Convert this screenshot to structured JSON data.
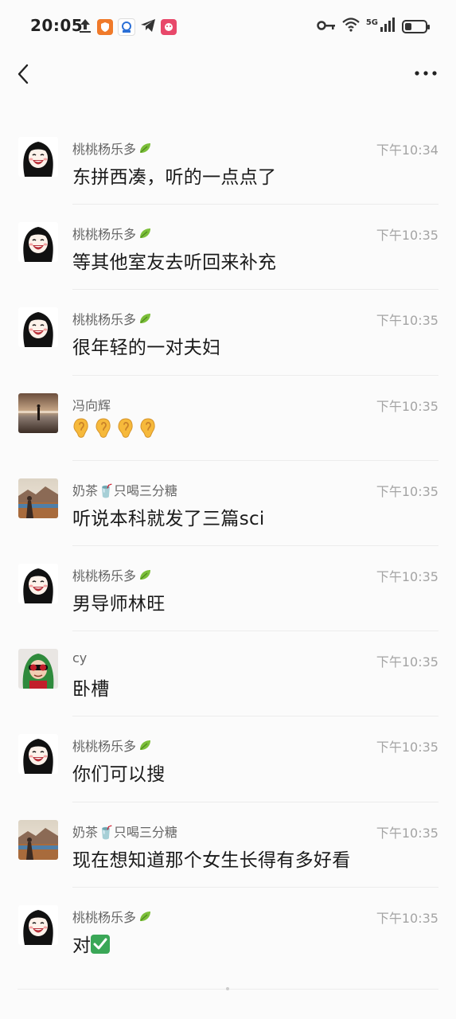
{
  "status_bar": {
    "time": "20:05",
    "network": "5G",
    "battery_level": 0.35,
    "left_icons": [
      "upload-icon",
      "shield-app-icon",
      "bank-app-icon",
      "telegram-icon",
      "game-app-icon"
    ],
    "right_icons": [
      "key-icon",
      "wifi-icon",
      "signal-icon",
      "battery-icon"
    ]
  },
  "nav": {
    "back_icon": "back-chevron-icon",
    "more_icon": "more-dots-icon"
  },
  "messages": [
    {
      "sender": "桃桃杨乐多",
      "leaf": true,
      "time": "下午10:34",
      "text": "东拼西凑，听的一点点了",
      "avatar": "cartoon-girl"
    },
    {
      "sender": "桃桃杨乐多",
      "leaf": true,
      "time": "下午10:35",
      "text": "等其他室友去听回来补充",
      "avatar": "cartoon-girl"
    },
    {
      "sender": "桃桃杨乐多",
      "leaf": true,
      "time": "下午10:35",
      "text": "很年轻的一对夫妇",
      "avatar": "cartoon-girl"
    },
    {
      "sender": "冯向辉",
      "leaf": false,
      "time": "下午10:35",
      "text": "",
      "ears": 4,
      "avatar": "beach-photo"
    },
    {
      "sender": "奶茶🥤只喝三分糖",
      "leaf": false,
      "time": "下午10:35",
      "text": "听说本科就发了三篇sci",
      "avatar": "mountain-photo"
    },
    {
      "sender": "桃桃杨乐多",
      "leaf": true,
      "time": "下午10:35",
      "text": "男导师林旺",
      "avatar": "cartoon-girl"
    },
    {
      "sender": "cy",
      "leaf": false,
      "time": "下午10:35",
      "text": "卧槽",
      "avatar": "green-hood-child"
    },
    {
      "sender": "桃桃杨乐多",
      "leaf": true,
      "time": "下午10:35",
      "text": "你们可以搜",
      "avatar": "cartoon-girl"
    },
    {
      "sender": "奶茶🥤只喝三分糖",
      "leaf": false,
      "time": "下午10:35",
      "text": "现在想知道那个女生长得有多好看",
      "avatar": "mountain-photo"
    },
    {
      "sender": "桃桃杨乐多",
      "leaf": true,
      "time": "下午10:35",
      "text": "对",
      "check": true,
      "avatar": "cartoon-girl"
    }
  ]
}
